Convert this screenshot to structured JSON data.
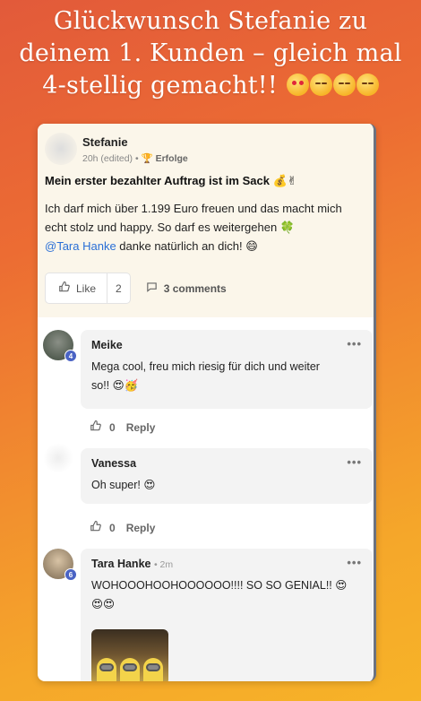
{
  "headline": {
    "line1": "Glückwunsch Stefanie zu",
    "line2": "deinem 1. Kunden – gleich mal",
    "line3": "4-stellig gemacht!!"
  },
  "post": {
    "author": "Stefanie",
    "time": "20h (edited)",
    "separator": "•",
    "category": "Erfolge",
    "title": "Mein erster bezahlter Auftrag ist im Sack 💰✌",
    "body_line1": "Ich darf mich über 1.199 Euro freuen und das macht mich",
    "body_line2": "echt stolz und happy. So darf es weitergehen 🍀",
    "mention": "@Tara Hanke",
    "body_line3_rest": " danke natürlich an dich! 😄",
    "like_label": "Like",
    "like_count": "2",
    "comments_label": "3 comments"
  },
  "comments": [
    {
      "name": "Meike",
      "badge": "4",
      "text_line1": "Mega cool, freu mich riesig für dich und weiter",
      "text_line2": "so!! 😍🥳",
      "likes": "0",
      "reply": "Reply"
    },
    {
      "name": "Vanessa",
      "text_line1": "Oh super! 😍",
      "likes": "0",
      "reply": "Reply"
    },
    {
      "name": "Tara Hanke",
      "time": "• 2m",
      "badge": "6",
      "text_line1": "WOHOOOHOOHOOOOOO!!!! SO SO GENIAL!! 😍",
      "text_line2": "😍😍"
    }
  ],
  "icons": {
    "dots": "•••",
    "like": "thumbs-up-icon",
    "comment": "comment-bubble-icon"
  }
}
